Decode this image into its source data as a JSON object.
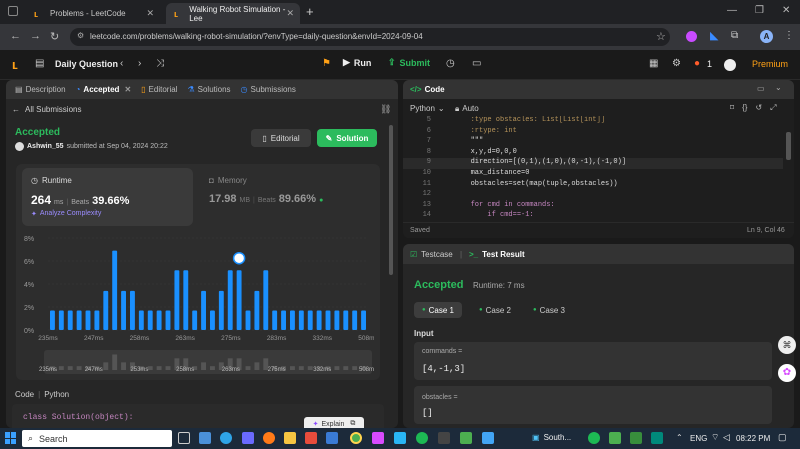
{
  "browser": {
    "tabs": [
      {
        "title": "Problems - LeetCode"
      },
      {
        "title": "Walking Robot Simulation - Lee"
      }
    ],
    "url": "leetcode.com/problems/walking-robot-simulation/?envType=daily-question&envId=2024-09-04",
    "profile": "A"
  },
  "header": {
    "title": "Daily Question",
    "run_label": "Run",
    "submit_label": "Submit",
    "streak": "1",
    "premium_label": "Premium"
  },
  "left": {
    "tabs": [
      "Description",
      "Accepted",
      "Editorial",
      "Solutions",
      "Submissions"
    ],
    "back_label": "All Submissions",
    "status": "Accepted",
    "user": "Ashwin_55",
    "submitted": "submitted at Sep 04, 2024 20:22",
    "editorial_btn": "Editorial",
    "solution_btn": "Solution",
    "runtime_label": "Runtime",
    "runtime_value": "264",
    "runtime_unit": "ms",
    "runtime_beats_label": "Beats",
    "runtime_beats": "39.66%",
    "analyze": "Analyze Complexity",
    "memory_label": "Memory",
    "memory_value": "17.98",
    "memory_unit": "MB",
    "memory_beats_label": "Beats",
    "memory_beats": "89.66%",
    "code_label": "Code",
    "code_lang": "Python",
    "code_line": "class Solution(object):",
    "explain_btn": "Explain"
  },
  "chart_data": {
    "type": "bar",
    "ylabel": "",
    "xlabel": "",
    "yticks": [
      "8%",
      "6%",
      "4%",
      "2%",
      "0%"
    ],
    "ylim": [
      0,
      8
    ],
    "xticks": [
      "235ms",
      "247ms",
      "258ms",
      "263ms",
      "275ms",
      "283ms",
      "332ms",
      "508ms"
    ],
    "values": [
      1.7,
      1.7,
      1.7,
      1.7,
      1.7,
      1.7,
      3.4,
      6.9,
      3.4,
      3.4,
      1.7,
      1.7,
      1.7,
      1.7,
      5.2,
      5.2,
      1.7,
      3.4,
      1.7,
      3.4,
      5.2,
      5.2,
      1.7,
      3.4,
      5.2,
      1.7,
      1.7,
      1.7,
      1.7,
      1.7,
      1.7,
      1.7,
      1.7,
      1.7,
      1.7,
      1.7
    ],
    "highlight_index": 21,
    "bar_color": "#1a90ff",
    "mini_xticks": [
      "235ms",
      "247ms",
      "253ms",
      "258ms",
      "263ms",
      "275ms",
      "332ms",
      "508ms"
    ]
  },
  "editor": {
    "title": "Code",
    "lang": "Python",
    "mode": "Auto",
    "saved": "Saved",
    "position": "Ln 9, Col 46",
    "lines": [
      {
        "n": "5",
        "text": "        :type obstacles: List[List[int]]"
      },
      {
        "n": "6",
        "text": "        :rtype: int"
      },
      {
        "n": "7",
        "text": "        \"\"\""
      },
      {
        "n": "8",
        "text": "        x,y,d=0,0,0"
      },
      {
        "n": "9",
        "text": "        direction=[(0,1),(1,0),(0,-1),(-1,0)]"
      },
      {
        "n": "10",
        "text": "        max_distance=0"
      },
      {
        "n": "11",
        "text": "        obstacles=set(map(tuple,obstacles))"
      },
      {
        "n": "12",
        "text": ""
      },
      {
        "n": "13",
        "text": "        for cmd in commands:"
      },
      {
        "n": "14",
        "text": "            if cmd==-1:"
      }
    ]
  },
  "result": {
    "testcase_tab": "Testcase",
    "result_tab": "Test Result",
    "status": "Accepted",
    "runtime": "Runtime: 7 ms",
    "cases": [
      "Case 1",
      "Case 2",
      "Case 3"
    ],
    "input_label": "Input",
    "var1_name": "commands =",
    "var1_value": "[4,-1,3]",
    "var2_name": "obstacles =",
    "var2_value": "[]"
  },
  "taskbar": {
    "search": "Search",
    "app_label": "South...",
    "lang": "ENG",
    "time": "08:22 PM"
  }
}
